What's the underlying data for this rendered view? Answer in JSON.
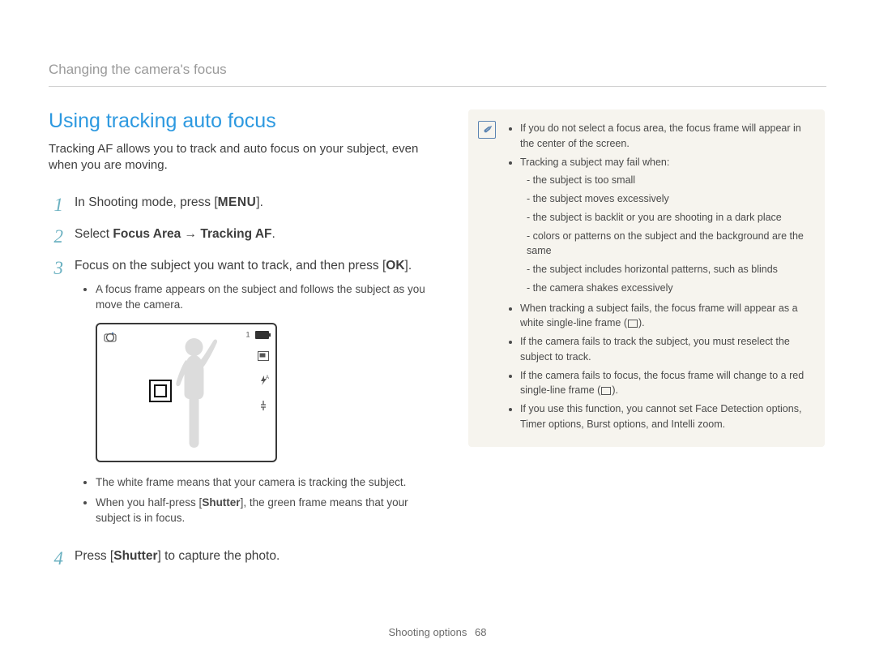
{
  "breadcrumb": "Changing the camera's focus",
  "title": "Using tracking auto focus",
  "lead": "Tracking AF allows you to track and auto focus on your subject, even when you are moving.",
  "steps": [
    {
      "num": "1",
      "pre": "In Shooting mode, press [",
      "btn": "MENU",
      "post": "]."
    },
    {
      "num": "2",
      "pre": "Select ",
      "bold1": "Focus Area",
      "arrow": " → ",
      "bold2": "Tracking AF",
      "end": "."
    },
    {
      "num": "3",
      "pre": "Focus on the subject you want to track, and then press [",
      "btn": "OK",
      "post": "].",
      "bullets": [
        "A focus frame appears on the subject and follows the subject as you move the camera."
      ],
      "bullets2": [
        "The white frame means that your camera is tracking the subject.",
        {
          "a": "When you half-press [",
          "b": "Shutter",
          "c": "], the green frame means that your subject is in focus."
        }
      ]
    },
    {
      "num": "4",
      "pre": "Press [",
      "bold1": "Shutter",
      "post": "] to capture the photo."
    }
  ],
  "preview": {
    "count": "1",
    "mode_icon": "camera-mode-icon",
    "side_icons": [
      "size-icon",
      "flash-icon",
      "stabilizer-icon"
    ]
  },
  "notes": [
    {
      "t": "If you do not select a focus area, the focus frame will appear in the center of the screen."
    },
    {
      "t": "Tracking a subject may fail when:",
      "sub": [
        "the subject is too small",
        "the subject moves excessively",
        "the subject is backlit or you are shooting in a dark place",
        "colors or patterns on the subject and the background are the same",
        "the subject includes horizontal patterns, such as blinds",
        "the camera shakes excessively"
      ]
    },
    {
      "a": "When tracking a subject fails, the focus frame will appear as a white single-line frame (",
      "b": ")."
    },
    {
      "t": "If the camera fails to track the subject, you must reselect the subject to track."
    },
    {
      "a": "If the camera fails to focus, the focus frame will change to a red single-line frame (",
      "b": ")."
    },
    {
      "t": "If you use this function, you cannot set Face Detection options, Timer options, Burst options, and Intelli zoom."
    }
  ],
  "footer": {
    "section": "Shooting options",
    "page": "68"
  }
}
